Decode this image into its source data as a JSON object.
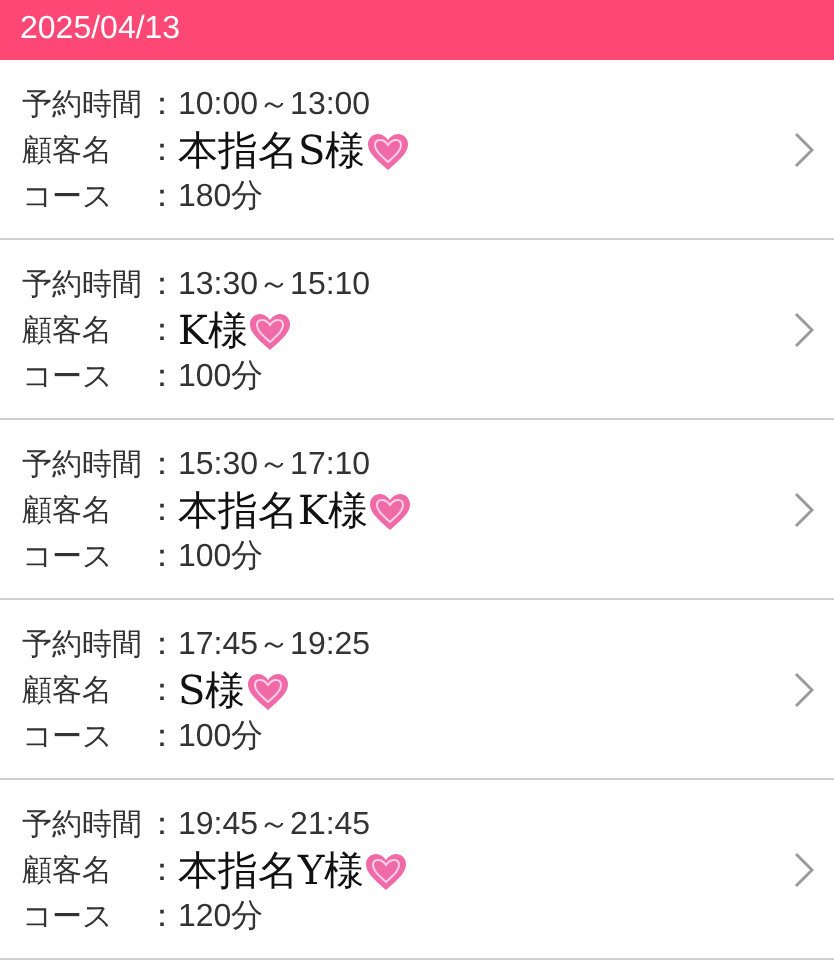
{
  "header": {
    "date": "2025/04/13"
  },
  "reservations": [
    {
      "time_label": "予約時間",
      "time": "：10:00～13:00",
      "customer_label": "顧客名",
      "customer_colon": "：",
      "customer": "本指名S様",
      "course_label": "コース",
      "course": "：180分"
    },
    {
      "time_label": "予約時間",
      "time": "：13:30～15:10",
      "customer_label": "顧客名",
      "customer_colon": "：",
      "customer": "K様",
      "course_label": "コース",
      "course": "：100分"
    },
    {
      "time_label": "予約時間",
      "time": "：15:30～17:10",
      "customer_label": "顧客名",
      "customer_colon": "：",
      "customer": "本指名K様",
      "course_label": "コース",
      "course": "：100分"
    },
    {
      "time_label": "予約時間",
      "time": "：17:45～19:25",
      "customer_label": "顧客名",
      "customer_colon": "：",
      "customer": "S様",
      "course_label": "コース",
      "course": "：100分"
    },
    {
      "time_label": "予約時間",
      "time": "：19:45～21:45",
      "customer_label": "顧客名",
      "customer_colon": "：",
      "customer": "本指名Y様",
      "course_label": "コース",
      "course": "：120分"
    }
  ]
}
